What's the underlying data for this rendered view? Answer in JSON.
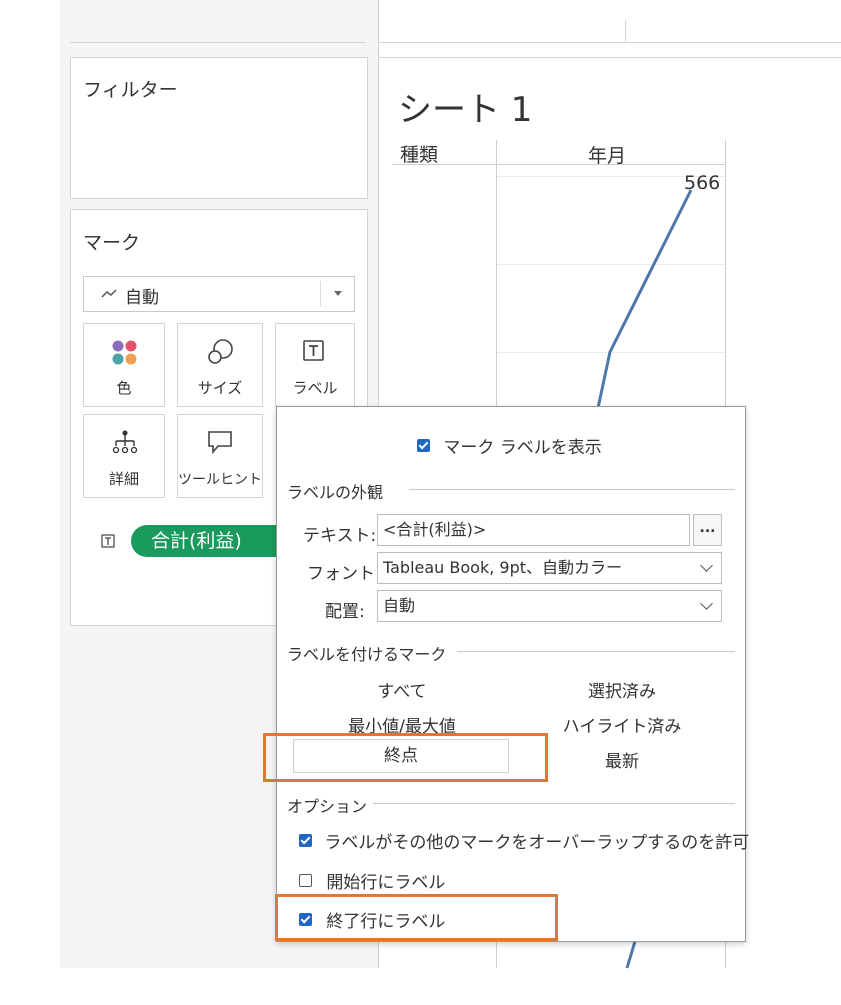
{
  "filters": {
    "title": "フィルター"
  },
  "marks": {
    "title": "マーク",
    "mark_type": "自動",
    "tiles": [
      {
        "label": "色",
        "icon": "color-icon"
      },
      {
        "label": "サイズ",
        "icon": "size-icon"
      },
      {
        "label": "ラベル",
        "icon": "label-icon"
      },
      {
        "label": "詳細",
        "icon": "detail-icon"
      },
      {
        "label": "ツールヒント",
        "icon": "tooltip-icon"
      }
    ],
    "pill": {
      "label": "合計(利益)",
      "color": "#1a9a5c"
    }
  },
  "sheet": {
    "title": "シート 1",
    "row_header": "種類",
    "column_header": "年月",
    "end_label": "566"
  },
  "chart_data": {
    "type": "line",
    "end_value_label": "566",
    "line_color": "#4e79a7"
  },
  "dialog": {
    "show_labels": {
      "label": "マーク ラベルを表示",
      "checked": true
    },
    "appearance": {
      "title": "ラベルの外観",
      "text_label": "テキスト:",
      "text_value": "<合計(利益)>",
      "more_button": "...",
      "font_label": "フォント:",
      "font_value": "Tableau Book, 9pt、自動カラー",
      "align_label": "配置:",
      "align_value": "自動"
    },
    "marks_to_label": {
      "title": "ラベルを付けるマーク",
      "options": {
        "all": "すべて",
        "selected": "選択済み",
        "minmax": "最小値/最大値",
        "highlighted": "ハイライト済み",
        "line_ends": "終点",
        "most_recent": "最新"
      },
      "active": "終点"
    },
    "options": {
      "title": "オプション",
      "allow_overlap": {
        "label": "ラベルがその他のマークをオーバーラップするのを許可",
        "checked": true
      },
      "label_start": {
        "label": "開始行にラベル",
        "checked": false
      },
      "label_end": {
        "label": "終了行にラベル",
        "checked": true
      }
    }
  },
  "highlight_color": "#e0782f",
  "accent_color": "#1f66c5"
}
